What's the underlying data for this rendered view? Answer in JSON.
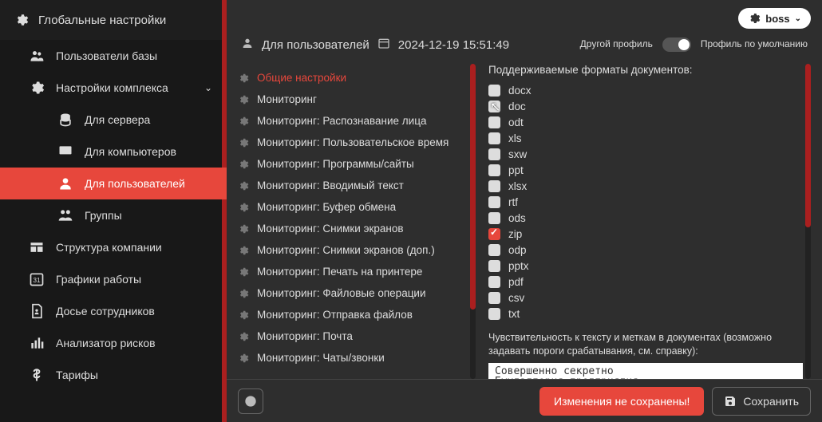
{
  "sidebar": {
    "title": "Глобальные настройки",
    "items": [
      {
        "label": "Пользователи базы"
      },
      {
        "label": "Настройки комплекса",
        "expandable": true
      },
      {
        "label": "Для сервера",
        "child": true
      },
      {
        "label": "Для компьютеров",
        "child": true
      },
      {
        "label": "Для пользователей",
        "child": true,
        "active": true
      },
      {
        "label": "Группы",
        "child": true
      },
      {
        "label": "Структура компании"
      },
      {
        "label": "Графики работы"
      },
      {
        "label": "Досье сотрудников"
      },
      {
        "label": "Анализатор рисков"
      },
      {
        "label": "Тарифы"
      }
    ]
  },
  "header": {
    "user": "boss",
    "subtitle": "Для пользователей",
    "datetime": "2024-12-19 15:51:49",
    "profile_left": "Другой профиль",
    "profile_right": "Профиль по умолчанию"
  },
  "settings_list": [
    {
      "label": "Общие настройки",
      "active": true
    },
    {
      "label": "Мониторинг"
    },
    {
      "label": "Мониторинг: Распознавание лица"
    },
    {
      "label": "Мониторинг: Пользовательское время"
    },
    {
      "label": "Мониторинг: Программы/сайты"
    },
    {
      "label": "Мониторинг: Вводимый текст"
    },
    {
      "label": "Мониторинг: Буфер обмена"
    },
    {
      "label": "Мониторинг: Снимки экранов"
    },
    {
      "label": "Мониторинг: Снимки экранов (доп.)"
    },
    {
      "label": "Мониторинг: Печать на принтере"
    },
    {
      "label": "Мониторинг: Файловые операции"
    },
    {
      "label": "Мониторинг: Отправка файлов"
    },
    {
      "label": "Мониторинг: Почта"
    },
    {
      "label": "Мониторинг: Чаты/звонки"
    }
  ],
  "form": {
    "formats_title": "Поддерживаемые форматы документов:",
    "formats": [
      {
        "label": "docx",
        "checked": false
      },
      {
        "label": "doc",
        "checked": false
      },
      {
        "label": "odt",
        "checked": false
      },
      {
        "label": "xls",
        "checked": false
      },
      {
        "label": "sxw",
        "checked": false
      },
      {
        "label": "ppt",
        "checked": false
      },
      {
        "label": "xlsx",
        "checked": false
      },
      {
        "label": "rtf",
        "checked": false
      },
      {
        "label": "ods",
        "checked": false
      },
      {
        "label": "zip",
        "checked": true
      },
      {
        "label": "odp",
        "checked": false
      },
      {
        "label": "pptx",
        "checked": false
      },
      {
        "label": "pdf",
        "checked": false
      },
      {
        "label": "csv",
        "checked": false
      },
      {
        "label": "txt",
        "checked": false
      }
    ],
    "sensitivity_text": "Чувствительность к тексту и меткам в документах (возможно задавать пороги срабатывания, см. справку):",
    "ta_value": "Совершенно секретно\nБухгалтерия предприятия"
  },
  "footer": {
    "warn": "Изменения не сохранены!",
    "save": "Сохранить"
  }
}
